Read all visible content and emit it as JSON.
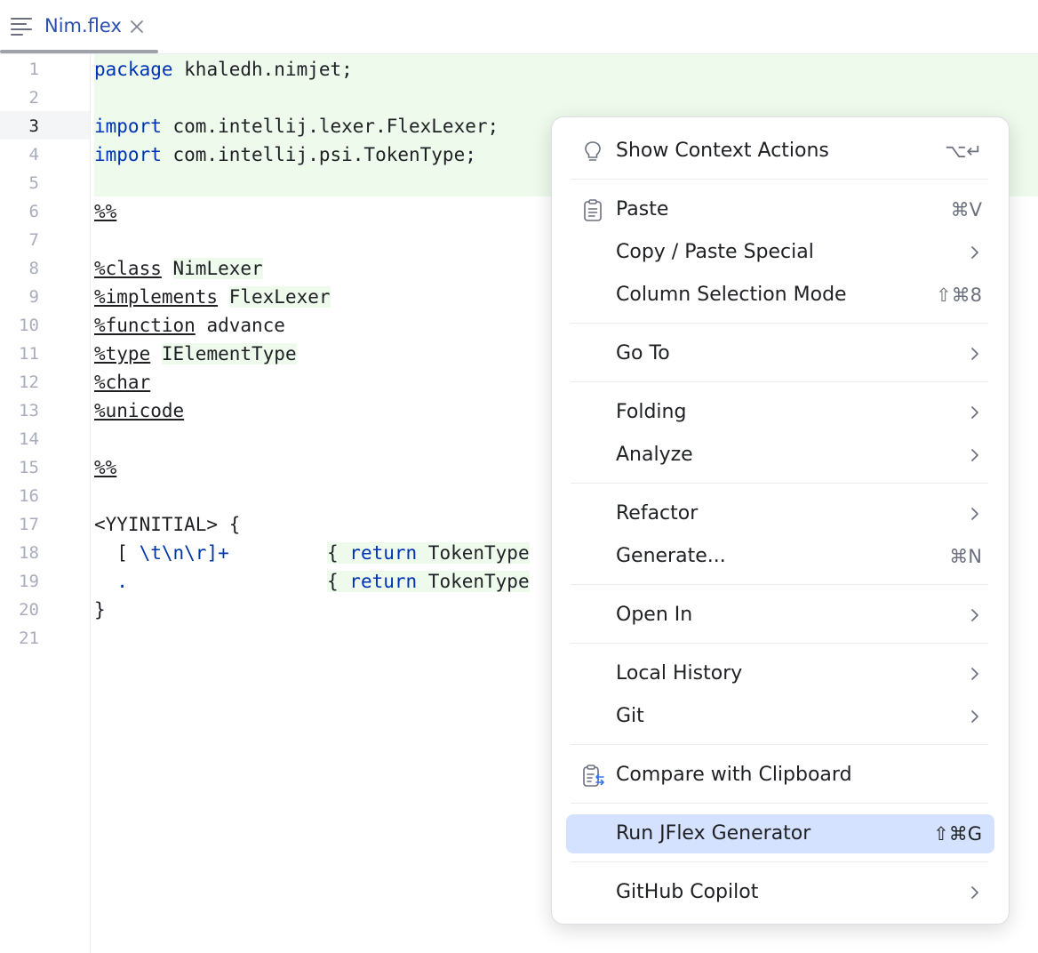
{
  "tab": {
    "label": "Nim.flex",
    "icon": "file-lines-icon"
  },
  "gutter": {
    "line_numbers": [
      "1",
      "2",
      "3",
      "4",
      "5",
      "6",
      "7",
      "8",
      "9",
      "10",
      "11",
      "12",
      "13",
      "14",
      "15",
      "16",
      "17",
      "18",
      "19",
      "20",
      "21"
    ],
    "current_line": "3"
  },
  "code": {
    "l1_kw": "package",
    "l1_rest": " khaledh.nimjet;",
    "l3_kw": "import",
    "l3_rest": " com.intellij.lexer.FlexLexer;",
    "l4_kw": "import",
    "l4_rest": " com.intellij.psi.TokenType;",
    "l6": "%%",
    "l8_dir": "%class",
    "l8_id": "NimLexer",
    "l9_dir": "%implements",
    "l9_id": "FlexLexer",
    "l10_dir": "%function",
    "l10_id": "advance",
    "l11_dir": "%type",
    "l11_id": "IElementType",
    "l12_dir": "%char",
    "l13_dir": "%unicode",
    "l15": "%%",
    "l17": "<YYINITIAL> {",
    "l18_pre": "  [ ",
    "l18_esc": "\\t\\n\\r",
    "l18_post": "]+",
    "l18_brace": "{ ",
    "l18_kw": "return",
    "l18_tail": " TokenType",
    "l19_dot": "  .",
    "l19_brace": "{ ",
    "l19_kw": "return",
    "l19_tail": " TokenType",
    "l20": "}"
  },
  "menu": {
    "show_context_actions": {
      "label": "Show Context Actions",
      "shortcut": "⌥↵",
      "icon": "lightbulb-icon"
    },
    "paste": {
      "label": "Paste",
      "shortcut": "⌘V",
      "icon": "clipboard-icon"
    },
    "copy_paste_special": {
      "label": "Copy / Paste Special"
    },
    "column_selection_mode": {
      "label": "Column Selection Mode",
      "shortcut": "⇧⌘8"
    },
    "go_to": {
      "label": "Go To"
    },
    "folding": {
      "label": "Folding"
    },
    "analyze": {
      "label": "Analyze"
    },
    "refactor": {
      "label": "Refactor"
    },
    "generate": {
      "label": "Generate...",
      "shortcut": "⌘N"
    },
    "open_in": {
      "label": "Open In"
    },
    "local_history": {
      "label": "Local History"
    },
    "git": {
      "label": "Git"
    },
    "compare_with_clipboard": {
      "label": "Compare with Clipboard",
      "icon": "compare-clipboard-icon"
    },
    "run_jflex_generator": {
      "label": "Run JFlex Generator",
      "shortcut": "⇧⌘G"
    },
    "github_copilot": {
      "label": "GitHub Copilot"
    }
  },
  "colors": {
    "accent": "#2a4fb0",
    "selection": "#d4e2ff",
    "added_line": "#edfaec",
    "keyword": "#0033b3"
  }
}
